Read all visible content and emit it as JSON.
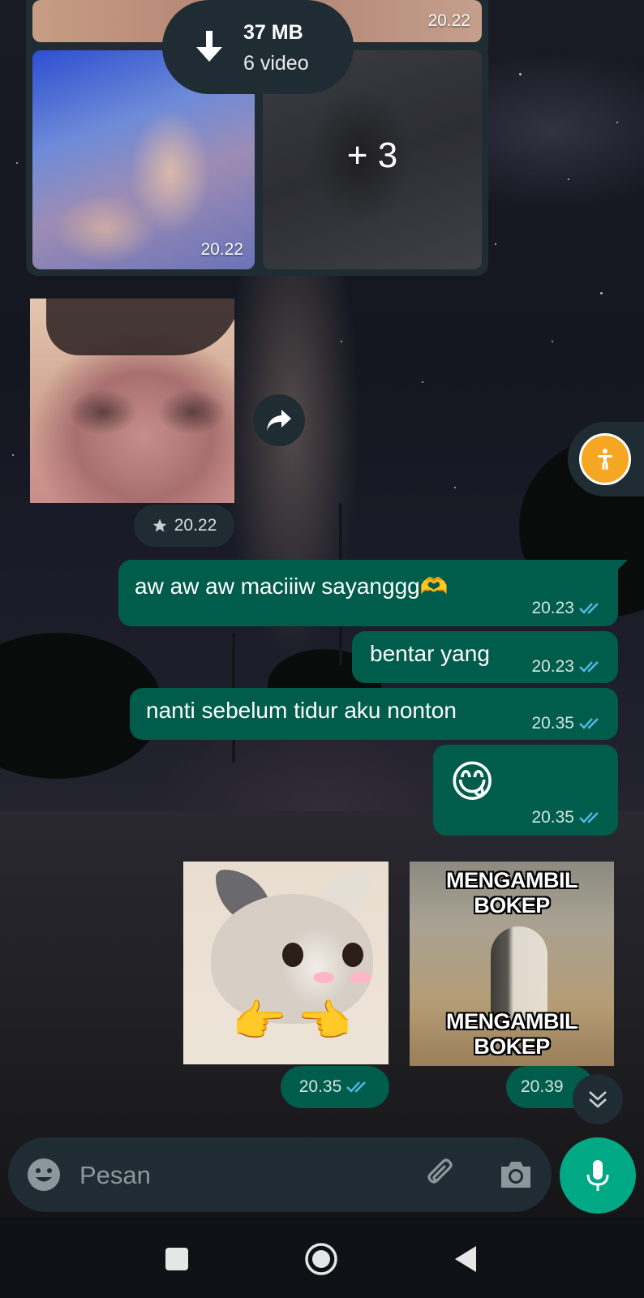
{
  "album": {
    "top_time": "20.22",
    "left_time": "20.22",
    "more_count": "+ 3",
    "download_size": "37 MB",
    "download_count": "6 video"
  },
  "photo": {
    "time": "20.22",
    "starred": true
  },
  "messages": [
    {
      "text": "aw aw aw maciiiw sayanggg🫶",
      "time": "20.23",
      "status": "read"
    },
    {
      "text": "bentar yang",
      "time": "20.23",
      "status": "read"
    },
    {
      "text": "nanti sebelum tidur aku nonton",
      "time": "20.35",
      "status": "read"
    },
    {
      "text": "😋",
      "time": "20.35",
      "status": "read"
    }
  ],
  "stickers": [
    {
      "time": "20.35",
      "status": "read"
    },
    {
      "time": "20.39",
      "top_text": "MENGAMBIL BOKEP",
      "bottom_text": "MENGAMBIL BOKEP"
    }
  ],
  "composer": {
    "placeholder": "Pesan"
  },
  "colors": {
    "outgoing_bubble": "#005c4b",
    "incoming_surface": "#1f2c33",
    "accent": "#00a884",
    "read_ticks": "#53bdeb",
    "accessibility": "#f5a623"
  },
  "icons": [
    "download-icon",
    "forward-icon",
    "accessibility-icon",
    "read-receipt-icon",
    "chevron-down-icon",
    "emoji-icon",
    "paperclip-icon",
    "camera-icon",
    "microphone-icon",
    "nav-recents-icon",
    "nav-home-icon",
    "nav-back-icon",
    "star-icon"
  ]
}
